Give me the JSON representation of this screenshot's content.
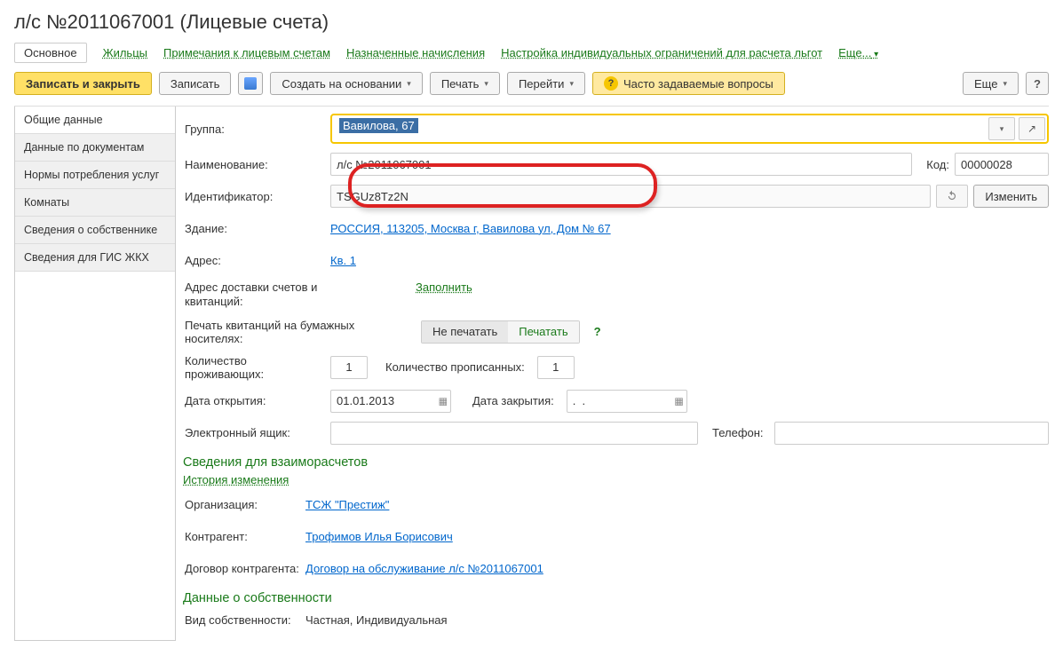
{
  "title": "л/с №2011067001 (Лицевые счета)",
  "nav": {
    "main": "Основное",
    "tenants": "Жильцы",
    "notes": "Примечания к лицевым счетам",
    "accruals": "Назначенные начисления",
    "limits": "Настройка индивидуальных ограничений для расчета льгот",
    "more": "Еще..."
  },
  "toolbar": {
    "saveClose": "Записать и закрыть",
    "save": "Записать",
    "create": "Создать на основании",
    "print": "Печать",
    "goto": "Перейти",
    "faq": "Часто задаваемые вопросы",
    "more": "Еще",
    "help": "?"
  },
  "sideTabs": [
    "Общие данные",
    "Данные по документам",
    "Нормы потребления услуг",
    "Комнаты",
    "Сведения о собственнике",
    "Сведения для ГИС ЖКХ"
  ],
  "labels": {
    "group": "Группа:",
    "name": "Наименование:",
    "code": "Код:",
    "identifier": "Идентификатор:",
    "changeBtn": "Изменить",
    "building": "Здание:",
    "address": "Адрес:",
    "deliveryAddress": "Адрес доставки счетов и квитанций:",
    "fill": "Заполнить",
    "printPaper": "Печать квитанций на бумажных носителях:",
    "toggleOff": "Не печатать",
    "toggleOn": "Печатать",
    "livingCount": "Количество проживающих:",
    "regCount": "Количество прописанных:",
    "openDate": "Дата открытия:",
    "closeDate": "Дата закрытия:",
    "email": "Электронный ящик:",
    "phone": "Телефон:",
    "settlementHeader": "Сведения для взаиморасчетов",
    "history": "История изменения",
    "org": "Организация:",
    "contragent": "Контрагент:",
    "contract": "Договор контрагента:",
    "ownershipHeader": "Данные о собственности",
    "ownershipType": "Вид собственности:"
  },
  "values": {
    "group": "Вавилова, 67",
    "name": "л/с №2011067001",
    "code": "00000028",
    "identifier": "TSGUz8Tz2N",
    "building": "РОССИЯ, 113205, Москва г, Вавилова ул, Дом № 67",
    "address": "Кв. 1",
    "living": "1",
    "registered": "1",
    "openDate": "01.01.2013",
    "closeDate": ".  .",
    "org": "ТСЖ \"Престиж\"",
    "contragent": "Трофимов Илья Борисович",
    "contract": "Договор на обслуживание л/с №2011067001",
    "ownership": "Частная, Индивидуальная"
  }
}
